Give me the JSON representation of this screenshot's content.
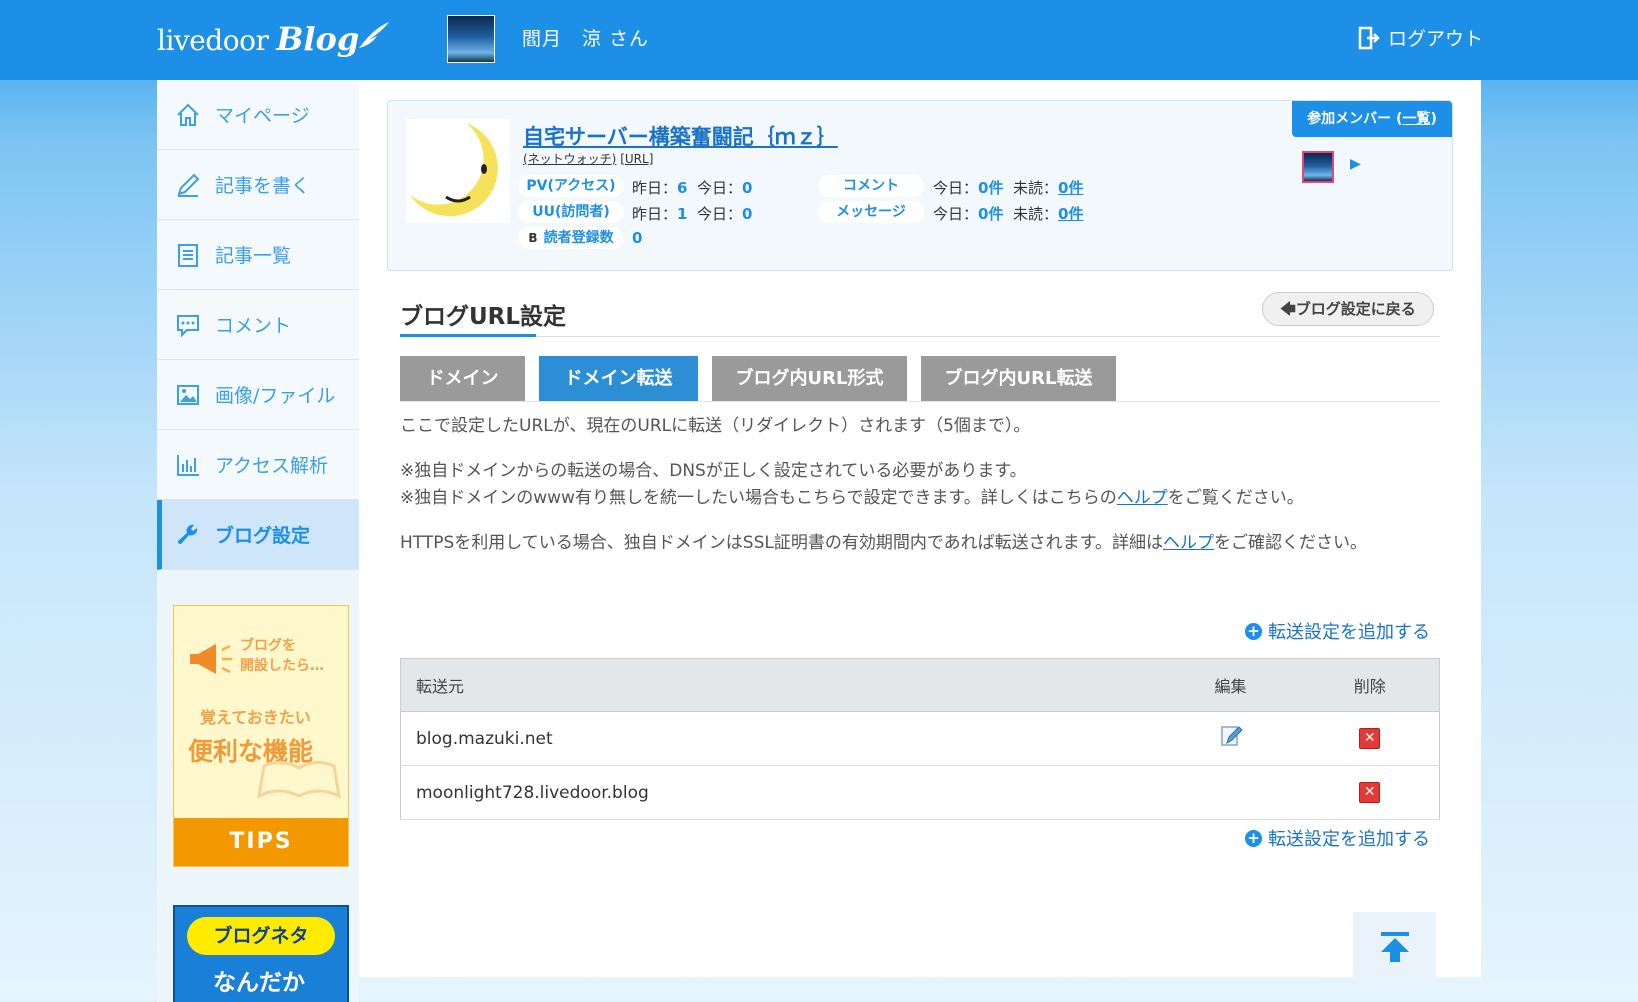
{
  "header": {
    "logo_text": "livedoor",
    "logo_blog": "Blog",
    "user_name": "閻月　涼 さん",
    "logout_label": "ログアウト"
  },
  "sidebar": {
    "items": [
      {
        "label": "マイページ",
        "icon": "home-icon"
      },
      {
        "label": "記事を書く",
        "icon": "pencil-icon"
      },
      {
        "label": "記事一覧",
        "icon": "document-list-icon"
      },
      {
        "label": "コメント",
        "icon": "comment-icon"
      },
      {
        "label": "画像/ファイル",
        "icon": "image-icon"
      },
      {
        "label": "アクセス解析",
        "icon": "bar-chart-icon"
      },
      {
        "label": "ブログ設定",
        "icon": "wrench-icon",
        "active": true
      }
    ],
    "banner_tips": {
      "line1": "ブログを",
      "line2": "開設したら…",
      "line3": "覚えておきたい",
      "line4": "便利な機能",
      "label": "TIPS"
    },
    "banner_neta": {
      "pill": "ブログネタ",
      "line1": "なんだか"
    }
  },
  "blog": {
    "title": "自宅サーバー構築奮闘記｛ｍｚ｝",
    "watch_link": "(ネットウォッチ)",
    "url_link": "[URL]",
    "pv_label": "PV(アクセス)",
    "pv_yesterday": "昨日：",
    "pv_yesterday_val": "6",
    "pv_today": "今日：",
    "pv_today_val": "0",
    "uu_label": "UU(訪問者)",
    "uu_yesterday": "昨日：",
    "uu_yesterday_val": "1",
    "uu_today": "今日：",
    "uu_today_val": "0",
    "reader_icon": "B",
    "reader_label": "読者登録数",
    "reader_val": "0",
    "comment_label": "コメント",
    "comment_today": "今日：",
    "comment_today_val": "0件",
    "comment_unread": "未読：",
    "comment_unread_val": "0件",
    "message_label": "メッセージ",
    "message_today": "今日：",
    "message_today_val": "0件",
    "message_unread": "未読：",
    "message_unread_val": "0件",
    "members_label": "参加メンバー (",
    "members_link": "一覧",
    "members_close": ")",
    "member_next": "▶"
  },
  "page": {
    "title": "ブログURL設定",
    "back_label": "ブログ設定に戻る",
    "tabs": [
      {
        "label": "ドメイン",
        "active": false
      },
      {
        "label": "ドメイン転送",
        "active": true
      },
      {
        "label": "ブログ内URL形式",
        "active": false
      },
      {
        "label": "ブログ内URL転送",
        "active": false
      }
    ],
    "desc1": "ここで設定したURLが、現在のURLに転送（リダイレクト）されます（5個まで）。",
    "desc2": "※独自ドメインからの転送の場合、DNSが正しく設定されている必要があります。",
    "desc3a": "※独自ドメインのwww有り無しを統一したい場合もこちらで設定できます。詳しくはこちらの",
    "desc3_link": "ヘルプ",
    "desc3b": "をご覧ください。",
    "desc4a": "HTTPSを利用している場合、独自ドメインはSSL証明書の有効期間内であれば転送されます。詳細は",
    "desc4_link": "ヘルプ",
    "desc4b": "をご確認ください。",
    "add_label": "転送設定を追加する",
    "add_icon": "+"
  },
  "table": {
    "headers": {
      "source": "転送元",
      "edit": "編集",
      "delete": "削除"
    },
    "rows": [
      {
        "source": "blog.mazuki.net",
        "editable": true
      },
      {
        "source": "moonlight728.livedoor.blog",
        "editable": false
      }
    ],
    "delete_glyph": "✕"
  },
  "colors": {
    "header_bg": "#1e8fe6",
    "accent": "#1e8fe6",
    "tab_active": "#2c8fd5",
    "tab_inactive": "#9a9a9a",
    "delete_red": "#e53935",
    "tips_orange": "#f39800"
  }
}
